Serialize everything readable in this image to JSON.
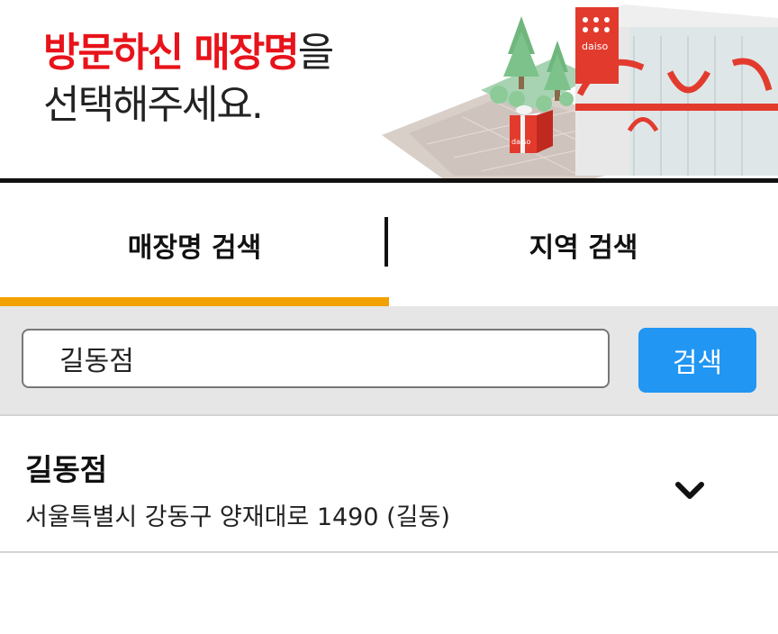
{
  "banner": {
    "line1_highlight": "방문하신 매장명",
    "line1_rest": "을",
    "line2": "선택해주세요.",
    "logo_text": "daiso",
    "accent_color": "#e8131a"
  },
  "tabs": [
    {
      "label": "매장명 검색",
      "active": true
    },
    {
      "label": "지역 검색",
      "active": false
    }
  ],
  "tab_active_color": "#f3a100",
  "search": {
    "value": "길동점",
    "button_label": "검색",
    "button_color": "#2196f3"
  },
  "results": [
    {
      "name": "길동점",
      "address": "서울특별시 강동구 양재대로 1490 (길동)",
      "icon": "chevron-down-icon"
    }
  ]
}
